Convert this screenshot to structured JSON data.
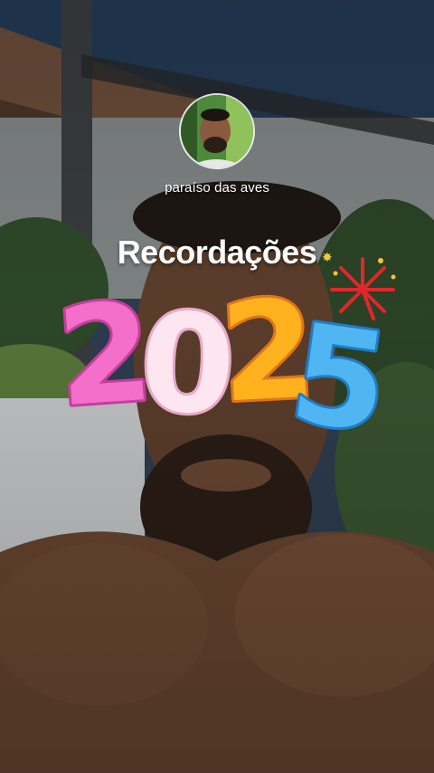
{
  "story": {
    "username": "paraíso das aves",
    "title": "Recordações",
    "sticker_year": "2025",
    "sticker_digit_colors": [
      "#f36fc9",
      "#fde6ef",
      "#ffb21e",
      "#4fb6f2"
    ]
  },
  "icons": {
    "avatar": "profile-photo",
    "sparkle": "sparkle-icon",
    "firework": "firework-icon"
  }
}
